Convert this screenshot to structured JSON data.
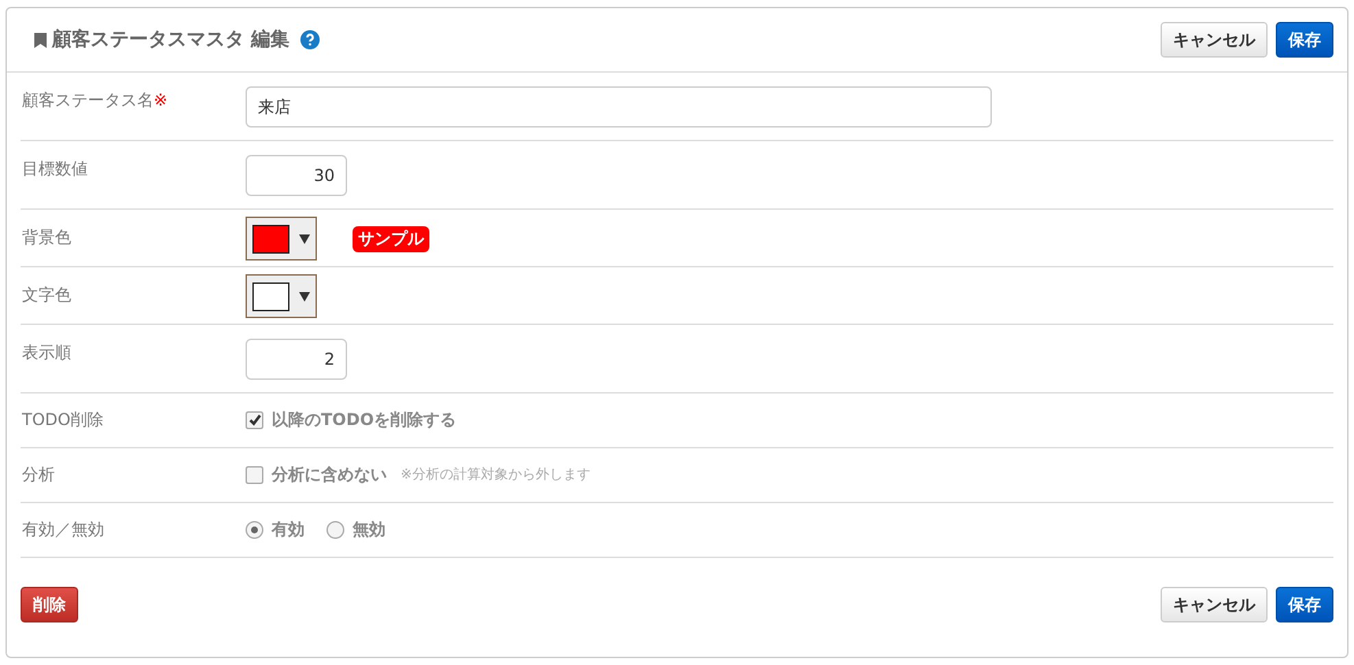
{
  "header": {
    "title": "顧客ステータスマスタ 編集",
    "buttons": [
      {
        "label": "キャンセル",
        "kind": "default"
      },
      {
        "label": "保存",
        "kind": "primary"
      }
    ]
  },
  "fields": [
    {
      "kind": "text",
      "label": "顧客ステータス名",
      "required_mark": "※",
      "value": "来店"
    },
    {
      "kind": "number",
      "label": "目標数値",
      "value": "30"
    },
    {
      "kind": "color",
      "label": "背景色",
      "color": "#ff0000",
      "sample": "サンプル"
    },
    {
      "kind": "color",
      "label": "文字色",
      "color": "#ffffff"
    },
    {
      "kind": "number",
      "label": "表示順",
      "value": "2"
    },
    {
      "kind": "checkbox",
      "label": "TODO削除",
      "option": "以降のTODOを削除する",
      "checked": true
    },
    {
      "kind": "checkbox",
      "label": "分析",
      "option": "分析に含めない",
      "checked": false,
      "note": "※分析の計算対象から外します"
    },
    {
      "kind": "radio",
      "label": "有効／無効",
      "options": [
        {
          "label": "有効",
          "selected": true
        },
        {
          "label": "無効",
          "selected": false
        }
      ]
    }
  ],
  "footer": {
    "delete": "削除",
    "buttons": [
      {
        "label": "キャンセル",
        "kind": "default"
      },
      {
        "label": "保存",
        "kind": "primary"
      }
    ]
  }
}
